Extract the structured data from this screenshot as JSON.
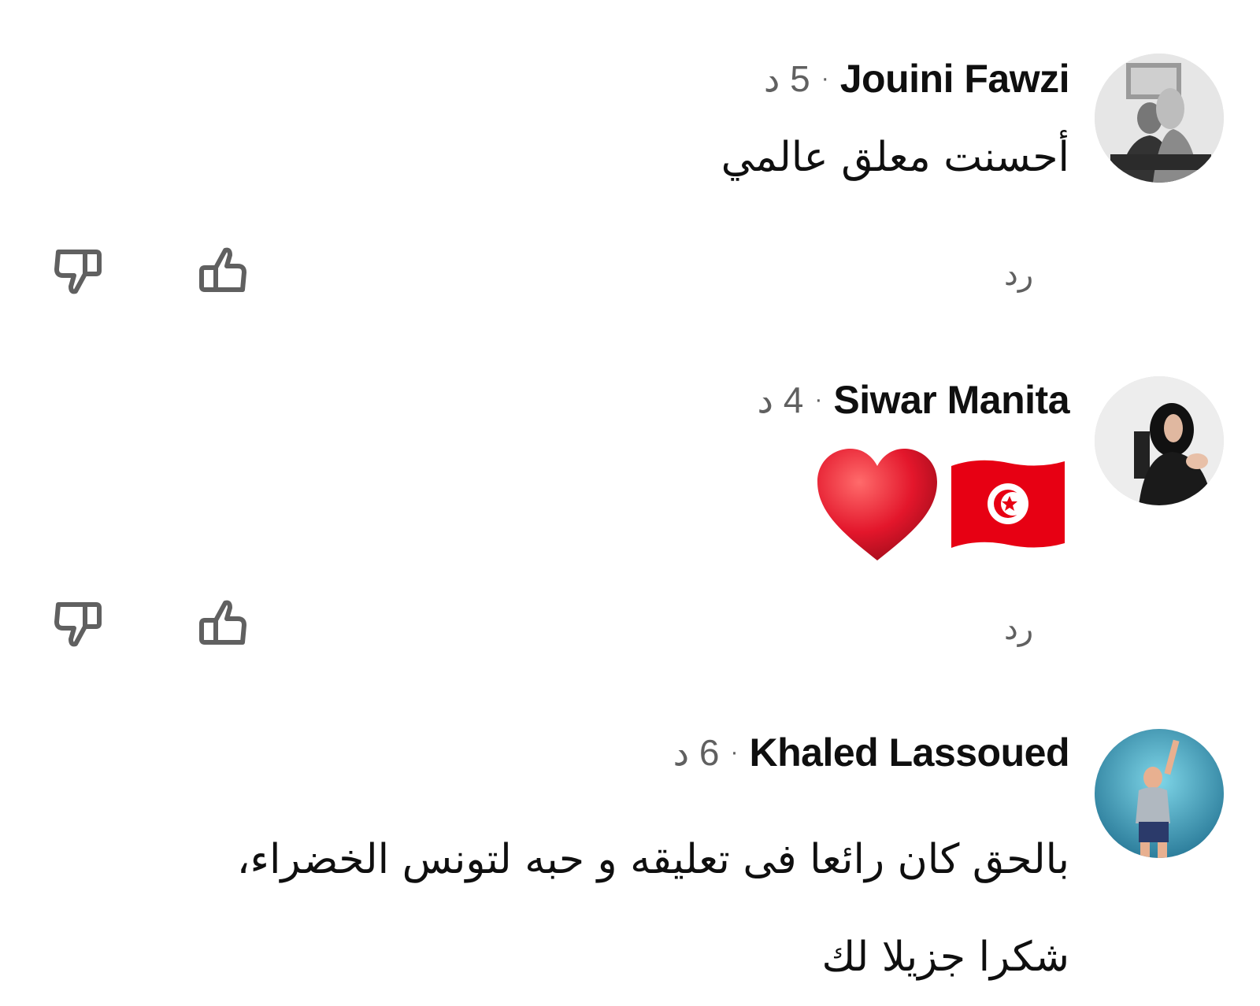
{
  "colors": {
    "background": "#ffffff",
    "author": "#0f0f0f",
    "secondary": "#606060",
    "icon_stroke": "#606060"
  },
  "comments": [
    {
      "author": "Jouini Fawzi",
      "separator": "·",
      "time": "5 د",
      "text_lines": [
        "أحسنت معلق عالمي"
      ],
      "reply_label": "رد",
      "avatar": "person-photo-avatar"
    },
    {
      "author": "Siwar Manita",
      "separator": "·",
      "time": "4 د",
      "emojis": [
        "tunisia-flag-emoji",
        "red-heart-emoji"
      ],
      "reply_label": "رد",
      "avatar": "person-photo-avatar"
    },
    {
      "author": "Khaled Lassoued",
      "separator": "·",
      "time": "6 د",
      "text_lines": [
        "بالحق كان رائعا فى تعليقه و حبه لتونس الخضراء،",
        "شكرا جزيلا لك"
      ],
      "avatar": "person-photo-avatar"
    }
  ]
}
